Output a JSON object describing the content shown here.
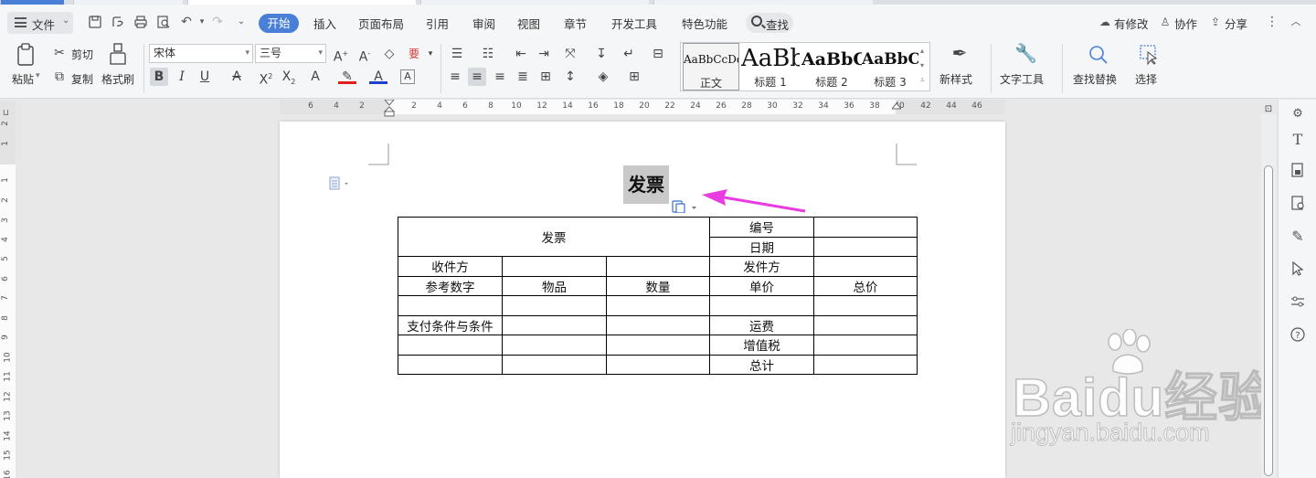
{
  "menu": {
    "file": "文件",
    "tabs": [
      "开始",
      "插入",
      "页面布局",
      "引用",
      "审阅",
      "视图",
      "章节",
      "开发工具",
      "特色功能"
    ],
    "search": "查找",
    "right": [
      "有修改",
      "协作",
      "分享"
    ]
  },
  "ribbon": {
    "paste": "粘贴",
    "cut": "剪切",
    "copy": "复制",
    "format_painter": "格式刷",
    "font_name": "宋体",
    "font_size": "三号",
    "styles": [
      {
        "preview": "AaBbCcDd",
        "label": "正文"
      },
      {
        "preview": "AaBb",
        "label": "标题 1"
      },
      {
        "preview": "AaBbC",
        "label": "标题 2"
      },
      {
        "preview": "AaBbC",
        "label": "标题 3"
      }
    ],
    "new_style": "新样式",
    "text_tools": "文字工具",
    "find_replace": "查找替换",
    "select": "选择"
  },
  "ruler": {
    "h": [
      "6",
      "4",
      "2",
      "2",
      "4",
      "6",
      "8",
      "10",
      "12",
      "14",
      "16",
      "18",
      "20",
      "22",
      "24",
      "26",
      "28",
      "30",
      "32",
      "34",
      "36",
      "38",
      "40",
      "42",
      "44",
      "46"
    ],
    "v": [
      "2",
      "1",
      "1",
      "2",
      "3",
      "4",
      "5",
      "6",
      "7",
      "8",
      "9",
      "10",
      "11",
      "12",
      "13",
      "14",
      "15",
      "16"
    ]
  },
  "document": {
    "title": "发票",
    "table": [
      [
        {
          "t": "发票",
          "cs": 3,
          "rs": 2
        },
        {
          "t": "编号"
        },
        {
          "t": ""
        }
      ],
      [
        {
          "t": "日期"
        },
        {
          "t": ""
        }
      ],
      [
        {
          "t": "收件方"
        },
        {
          "t": ""
        },
        {
          "t": ""
        },
        {
          "t": "发件方"
        },
        {
          "t": ""
        }
      ],
      [
        {
          "t": "参考数字"
        },
        {
          "t": "物品"
        },
        {
          "t": "数量"
        },
        {
          "t": "单价"
        },
        {
          "t": "总价"
        }
      ],
      [
        {
          "t": ""
        },
        {
          "t": ""
        },
        {
          "t": ""
        },
        {
          "t": ""
        },
        {
          "t": ""
        }
      ],
      [
        {
          "t": "支付条件与条件"
        },
        {
          "t": ""
        },
        {
          "t": ""
        },
        {
          "t": "运费"
        },
        {
          "t": ""
        }
      ],
      [
        {
          "t": ""
        },
        {
          "t": ""
        },
        {
          "t": ""
        },
        {
          "t": "增值税"
        },
        {
          "t": ""
        }
      ],
      [
        {
          "t": ""
        },
        {
          "t": ""
        },
        {
          "t": ""
        },
        {
          "t": "总计"
        },
        {
          "t": ""
        }
      ]
    ]
  },
  "watermark": {
    "brand": "Baidu经验",
    "url": "jingyan.baidu.com"
  },
  "colors": {
    "accent": "#4a7fd8",
    "arrow": "#e83be0"
  }
}
